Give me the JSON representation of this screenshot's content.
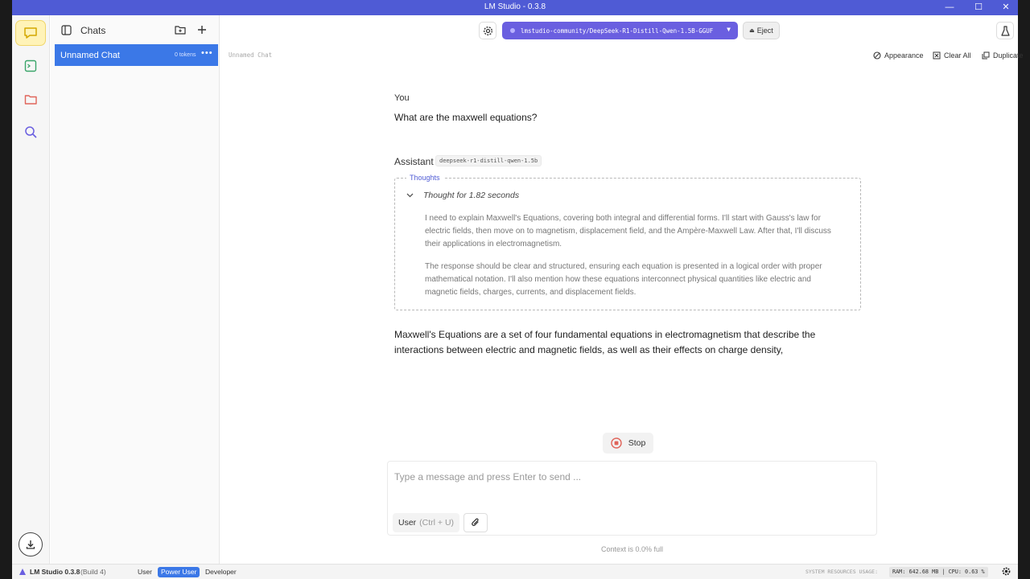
{
  "window": {
    "title": "LM Studio - 0.3.8",
    "minimize": "—",
    "maximize": "☐",
    "close": "✕"
  },
  "sidebar": {
    "title": "Chats",
    "chats": [
      {
        "name": "Unnamed Chat",
        "tokens": "0 tokens",
        "active": true
      }
    ]
  },
  "topbar": {
    "model": "lmstudio-community/DeepSeek-R1-Distill-Qwen-1.5B-GGUF",
    "eject_label": "Eject"
  },
  "chat": {
    "title": "Unnamed Chat",
    "actions": {
      "appearance": "Appearance",
      "clear_all": "Clear All",
      "duplicate": "Duplicate"
    },
    "user": {
      "label": "You",
      "message": "What are the maxwell equations?"
    },
    "assistant": {
      "label": "Assistant",
      "model_tag": "deepseek-r1-distill-qwen-1.5b",
      "thoughts_label": "Thoughts",
      "thought_summary": "Thought for 1.82 seconds",
      "thought_paragraphs": [
        "I need to explain Maxwell's Equations, covering both integral and differential forms. I'll start with Gauss's law for electric fields, then move on to magnetism, displacement field, and the Ampère-Maxwell Law. After that, I'll discuss their applications in electromagnetism.",
        "The response should be clear and structured, ensuring each equation is presented in a logical order with proper mathematical notation. I'll also mention how these equations interconnect physical quantities like electric and magnetic fields, charges, currents, and displacement fields."
      ],
      "answer": "Maxwell's Equations are a set of four fundamental equations in electromagnetism that describe the interactions between electric and magnetic fields, as well as their effects on charge density,"
    },
    "stop_label": "Stop"
  },
  "composer": {
    "placeholder": "Type a message and press Enter to send ...",
    "role": "User",
    "role_shortcut": "(Ctrl + U)",
    "context": "Context is 0.0% full"
  },
  "statusbar": {
    "app": "LM Studio 0.3.8",
    "build": "(Build 4)",
    "modes": [
      "User",
      "Power User",
      "Developer"
    ],
    "active_mode": "Power User",
    "resources_label": "SYSTEM RESOURCES USAGE:",
    "resources": "RAM: 642.68 MB | CPU: 0.63 %"
  },
  "colors": {
    "titlebar": "#4f5bd5",
    "accent": "#3b78e7",
    "model_button": "#6a5fe0",
    "rail_active": "#fff3b8"
  }
}
